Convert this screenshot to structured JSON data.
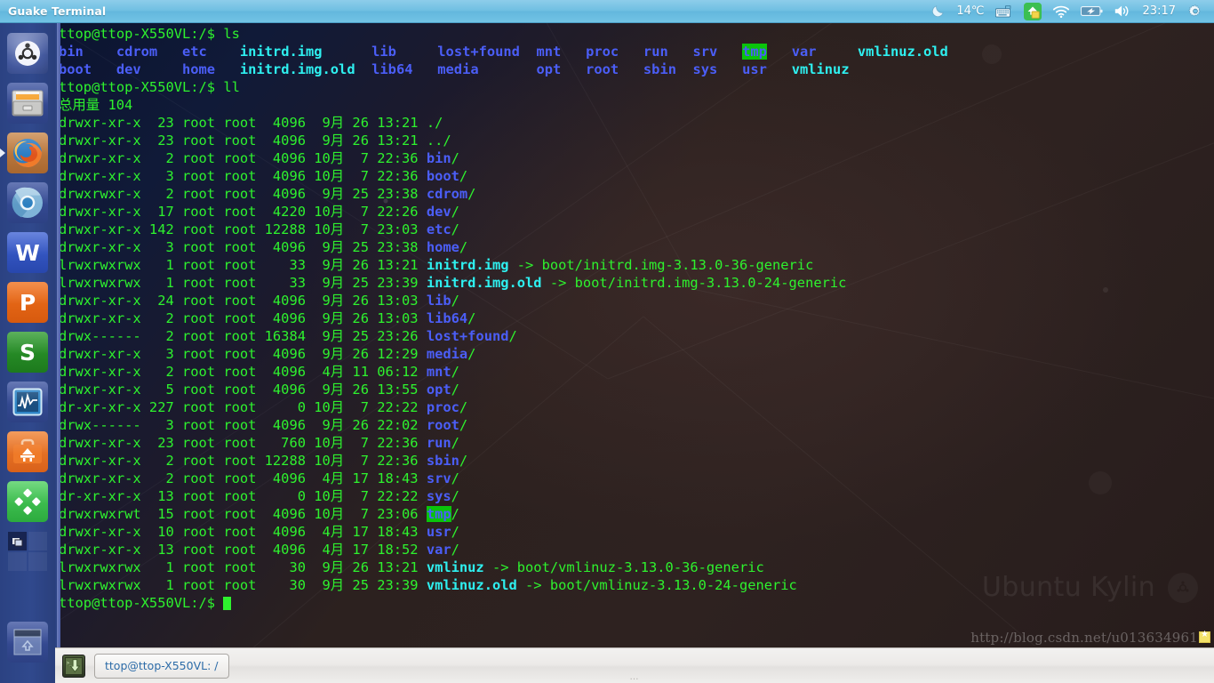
{
  "panel": {
    "title": "Guake Terminal",
    "tray": {
      "weather_icon": "moon-icon",
      "temperature": "14℃",
      "keyboard_icon": "keyboard-indicator-icon",
      "update_icon": "software-updater-icon",
      "network_icon": "wifi-icon",
      "battery_icon": "battery-charging-icon",
      "volume_icon": "volume-icon",
      "clock": "23:17",
      "settings_icon": "gear-icon"
    }
  },
  "launcher": {
    "items": [
      {
        "name": "ubuntu-dash",
        "label": "Dash Home",
        "icon": "ubuntu-logo-icon",
        "running": false
      },
      {
        "name": "files",
        "label": "Files",
        "icon": "file-cabinet-icon",
        "running": false
      },
      {
        "name": "firefox",
        "label": "Firefox Web Browser",
        "icon": "firefox-icon",
        "running": true
      },
      {
        "name": "chromium",
        "label": "Chromium Web Browser",
        "icon": "chromium-icon",
        "running": false
      },
      {
        "name": "wps-writer",
        "label": "WPS Writer",
        "icon": "wps-writer-icon",
        "glyph": "W",
        "running": false
      },
      {
        "name": "wps-presentation",
        "label": "WPS Presentation",
        "icon": "wps-presentation-icon",
        "glyph": "P",
        "running": false
      },
      {
        "name": "wps-spreadsheets",
        "label": "WPS Spreadsheets",
        "icon": "wps-spreadsheets-icon",
        "glyph": "S",
        "running": false
      },
      {
        "name": "system-monitor",
        "label": "System Monitor",
        "icon": "system-monitor-icon",
        "running": false
      },
      {
        "name": "ubuntu-kylin-software-center",
        "label": "Ubuntu Kylin Software Center",
        "icon": "toolbox-icon",
        "running": false
      },
      {
        "name": "youker-assistant",
        "label": "Youker Assistant",
        "icon": "green-diamond-icon",
        "running": false
      },
      {
        "name": "workspace-switcher",
        "label": "Workspace Switcher",
        "icon": "workspace-switcher-icon",
        "running": false
      },
      {
        "name": "trash",
        "label": "Trash",
        "icon": "trash-icon",
        "running": false
      }
    ]
  },
  "terminal": {
    "scrollbar": true,
    "background_watermark": "Ubuntu Kylin",
    "cursor": "block",
    "lines": [
      [
        {
          "t": "ttop@ttop-X550VL:/$ ls",
          "c": "g"
        }
      ],
      [
        {
          "t": "bin    cdrom   etc    ",
          "c": "b"
        },
        {
          "t": "initrd.img",
          "c": "c"
        },
        {
          "t": "      ",
          "c": "g"
        },
        {
          "t": "lib     ",
          "c": "b"
        },
        {
          "t": "lost+found  mnt   proc   run   srv   ",
          "c": "b"
        },
        {
          "t": "tmp",
          "c": "hl"
        },
        {
          "t": "   var     ",
          "c": "b"
        },
        {
          "t": "vmlinuz.old",
          "c": "c"
        }
      ],
      [
        {
          "t": "boot   dev     home   ",
          "c": "b"
        },
        {
          "t": "initrd.img.old",
          "c": "c"
        },
        {
          "t": "  ",
          "c": "g"
        },
        {
          "t": "lib64   media       opt   root   sbin  sys   usr   ",
          "c": "b"
        },
        {
          "t": "vmlinuz",
          "c": "c"
        }
      ],
      [
        {
          "t": "ttop@ttop-X550VL:/$ ll",
          "c": "g"
        }
      ],
      [
        {
          "t": "总用量 104",
          "c": "g"
        }
      ],
      [
        {
          "t": "drwxr-xr-x  23 root root  4096  9月 26 13:21 ./",
          "c": "g"
        }
      ],
      [
        {
          "t": "drwxr-xr-x  23 root root  4096  9月 26 13:21 ../",
          "c": "g"
        }
      ],
      [
        {
          "t": "drwxr-xr-x   2 root root  4096 10月  7 22:36 ",
          "c": "g"
        },
        {
          "t": "bin",
          "c": "b"
        },
        {
          "t": "/",
          "c": "g"
        }
      ],
      [
        {
          "t": "drwxr-xr-x   3 root root  4096 10月  7 22:36 ",
          "c": "g"
        },
        {
          "t": "boot",
          "c": "b"
        },
        {
          "t": "/",
          "c": "g"
        }
      ],
      [
        {
          "t": "drwxrwxr-x   2 root root  4096  9月 25 23:38 ",
          "c": "g"
        },
        {
          "t": "cdrom",
          "c": "b"
        },
        {
          "t": "/",
          "c": "g"
        }
      ],
      [
        {
          "t": "drwxr-xr-x  17 root root  4220 10月  7 22:26 ",
          "c": "g"
        },
        {
          "t": "dev",
          "c": "b"
        },
        {
          "t": "/",
          "c": "g"
        }
      ],
      [
        {
          "t": "drwxr-xr-x 142 root root 12288 10月  7 23:03 ",
          "c": "g"
        },
        {
          "t": "etc",
          "c": "b"
        },
        {
          "t": "/",
          "c": "g"
        }
      ],
      [
        {
          "t": "drwxr-xr-x   3 root root  4096  9月 25 23:38 ",
          "c": "g"
        },
        {
          "t": "home",
          "c": "b"
        },
        {
          "t": "/",
          "c": "g"
        }
      ],
      [
        {
          "t": "lrwxrwxrwx   1 root root    33  9月 26 13:21 ",
          "c": "g"
        },
        {
          "t": "initrd.img",
          "c": "c"
        },
        {
          "t": " -> boot/initrd.img-3.13.0-36-generic",
          "c": "g"
        }
      ],
      [
        {
          "t": "lrwxrwxrwx   1 root root    33  9月 25 23:39 ",
          "c": "g"
        },
        {
          "t": "initrd.img.old",
          "c": "c"
        },
        {
          "t": " -> boot/initrd.img-3.13.0-24-generic",
          "c": "g"
        }
      ],
      [
        {
          "t": "drwxr-xr-x  24 root root  4096  9月 26 13:03 ",
          "c": "g"
        },
        {
          "t": "lib",
          "c": "b"
        },
        {
          "t": "/",
          "c": "g"
        }
      ],
      [
        {
          "t": "drwxr-xr-x   2 root root  4096  9月 26 13:03 ",
          "c": "g"
        },
        {
          "t": "lib64",
          "c": "b"
        },
        {
          "t": "/",
          "c": "g"
        }
      ],
      [
        {
          "t": "drwx------   2 root root 16384  9月 25 23:26 ",
          "c": "g"
        },
        {
          "t": "lost+found",
          "c": "b"
        },
        {
          "t": "/",
          "c": "g"
        }
      ],
      [
        {
          "t": "drwxr-xr-x   3 root root  4096  9月 26 12:29 ",
          "c": "g"
        },
        {
          "t": "media",
          "c": "b"
        },
        {
          "t": "/",
          "c": "g"
        }
      ],
      [
        {
          "t": "drwxr-xr-x   2 root root  4096  4月 11 06:12 ",
          "c": "g"
        },
        {
          "t": "mnt",
          "c": "b"
        },
        {
          "t": "/",
          "c": "g"
        }
      ],
      [
        {
          "t": "drwxr-xr-x   5 root root  4096  9月 26 13:55 ",
          "c": "g"
        },
        {
          "t": "opt",
          "c": "b"
        },
        {
          "t": "/",
          "c": "g"
        }
      ],
      [
        {
          "t": "dr-xr-xr-x 227 root root     0 10月  7 22:22 ",
          "c": "g"
        },
        {
          "t": "proc",
          "c": "b"
        },
        {
          "t": "/",
          "c": "g"
        }
      ],
      [
        {
          "t": "drwx------   3 root root  4096  9月 26 22:02 ",
          "c": "g"
        },
        {
          "t": "root",
          "c": "b"
        },
        {
          "t": "/",
          "c": "g"
        }
      ],
      [
        {
          "t": "drwxr-xr-x  23 root root   760 10月  7 22:36 ",
          "c": "g"
        },
        {
          "t": "run",
          "c": "b"
        },
        {
          "t": "/",
          "c": "g"
        }
      ],
      [
        {
          "t": "drwxr-xr-x   2 root root 12288 10月  7 22:36 ",
          "c": "g"
        },
        {
          "t": "sbin",
          "c": "b"
        },
        {
          "t": "/",
          "c": "g"
        }
      ],
      [
        {
          "t": "drwxr-xr-x   2 root root  4096  4月 17 18:43 ",
          "c": "g"
        },
        {
          "t": "srv",
          "c": "b"
        },
        {
          "t": "/",
          "c": "g"
        }
      ],
      [
        {
          "t": "dr-xr-xr-x  13 root root     0 10月  7 22:22 ",
          "c": "g"
        },
        {
          "t": "sys",
          "c": "b"
        },
        {
          "t": "/",
          "c": "g"
        }
      ],
      [
        {
          "t": "drwxrwxrwt  15 root root  4096 10月  7 23:06 ",
          "c": "g"
        },
        {
          "t": "tmp",
          "c": "hl"
        },
        {
          "t": "/",
          "c": "g"
        }
      ],
      [
        {
          "t": "drwxr-xr-x  10 root root  4096  4月 17 18:43 ",
          "c": "g"
        },
        {
          "t": "usr",
          "c": "b"
        },
        {
          "t": "/",
          "c": "g"
        }
      ],
      [
        {
          "t": "drwxr-xr-x  13 root root  4096  4月 17 18:52 ",
          "c": "g"
        },
        {
          "t": "var",
          "c": "b"
        },
        {
          "t": "/",
          "c": "g"
        }
      ],
      [
        {
          "t": "lrwxrwxrwx   1 root root    30  9月 26 13:21 ",
          "c": "g"
        },
        {
          "t": "vmlinuz",
          "c": "c"
        },
        {
          "t": " -> boot/vmlinuz-3.13.0-36-generic",
          "c": "g"
        }
      ],
      [
        {
          "t": "lrwxrwxrwx   1 root root    30  9月 25 23:39 ",
          "c": "g"
        },
        {
          "t": "vmlinuz.old",
          "c": "c"
        },
        {
          "t": " -> boot/vmlinuz-3.13.0-24-generic",
          "c": "g"
        }
      ],
      [
        {
          "t": "ttop@ttop-X550VL:/$ ",
          "c": "g"
        },
        {
          "t": "",
          "c": "cursor"
        }
      ]
    ]
  },
  "taskbar": {
    "launch_icon": "terminal-drop-icon",
    "window_button": "ttop@ttop-X550VL: /",
    "grip": "…"
  },
  "watermark": {
    "url": "http://blog.csdn.net/u013634961"
  },
  "colors": {
    "panel_blue": "#6fbfe2",
    "launcher_blue": "#30498d",
    "terminal_green": "#2ef22e",
    "terminal_dir_blue": "#4b5ef7",
    "terminal_link_cyan": "#2ef0f0",
    "tmp_highlight_bg": "#0ac40a"
  }
}
